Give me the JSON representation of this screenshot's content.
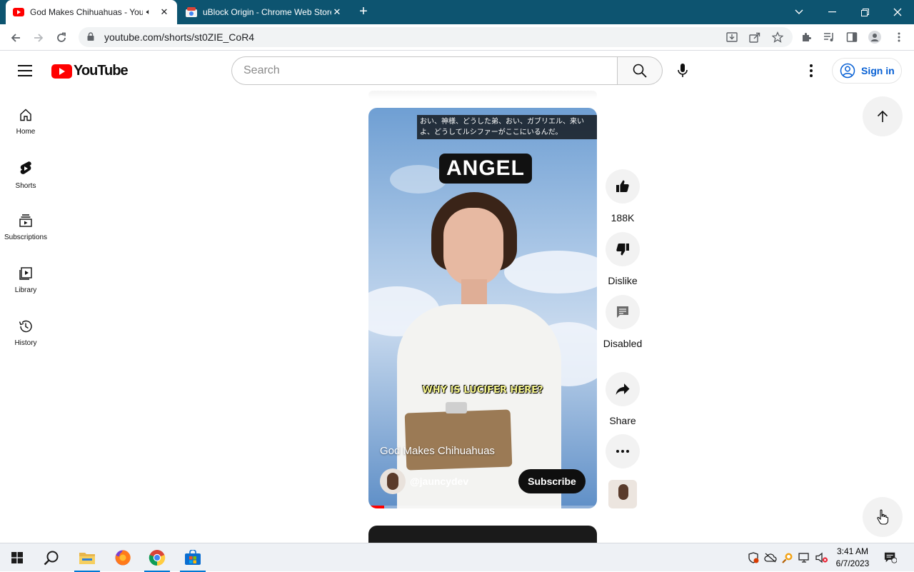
{
  "browser": {
    "tabs": [
      {
        "title": "God Makes Chihuahuas - YouTube",
        "active": true
      },
      {
        "title": "uBlock Origin - Chrome Web Store",
        "active": false
      }
    ],
    "url": "youtube.com/shorts/st0ZIE_CoR4"
  },
  "youtube": {
    "logo_text": "YouTube",
    "search_placeholder": "Search",
    "sign_in_label": "Sign in",
    "guide": [
      {
        "label": "Home"
      },
      {
        "label": "Shorts"
      },
      {
        "label": "Subscriptions"
      },
      {
        "label": "Library"
      },
      {
        "label": "History"
      }
    ]
  },
  "short": {
    "subtitle_jp": "おい、神様、どうした弟、おい、ガブリエル、来いよ、どうしてルシファーがここにいるんだ。",
    "overlay_title": "ANGEL",
    "caption": "WHY IS LUCIFER HERE?",
    "title": "God Makes Chihuahuas",
    "channel": "@jauncydev",
    "subscribe_label": "Subscribe",
    "progress": 0.07
  },
  "actions": {
    "likes": "188K",
    "dislike_label": "Dislike",
    "comments_label": "Disabled",
    "share_label": "Share"
  },
  "taskbar": {
    "time": "3:41 AM",
    "date": "6/7/2023"
  },
  "colors": {
    "tabstrip": "#0d5470",
    "youtube_red": "#ff0000",
    "signin_blue": "#065fd4"
  }
}
